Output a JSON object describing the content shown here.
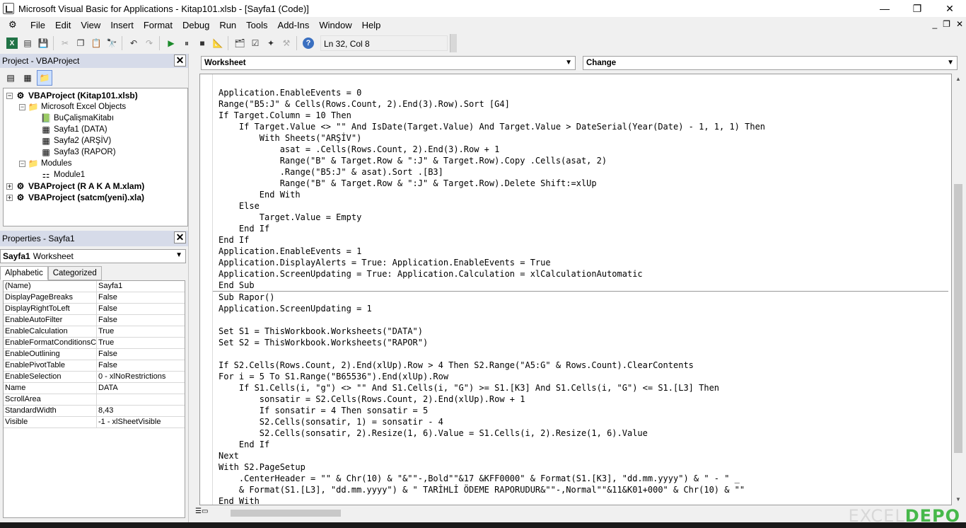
{
  "window": {
    "title": "Microsoft Visual Basic for Applications - Kitap101.xlsb - [Sayfa1 (Code)]",
    "minimize": "—",
    "maximize": "❐",
    "close": "✕"
  },
  "menu": {
    "items": [
      "File",
      "Edit",
      "View",
      "Insert",
      "Format",
      "Debug",
      "Run",
      "Tools",
      "Add-Ins",
      "Window",
      "Help"
    ],
    "mdi_minimize": "_",
    "mdi_restore": "❐",
    "mdi_close": "✕"
  },
  "toolbar": {
    "cursor_position": "Ln 32, Col 8"
  },
  "project": {
    "title": "Project - VBAProject",
    "tree": [
      {
        "label": "VBAProject (Kitap101.xlsb)",
        "level": 0,
        "expander": "−",
        "icon": "vba-project-icon",
        "bold": true
      },
      {
        "label": "Microsoft Excel Objects",
        "level": 1,
        "expander": "−",
        "icon": "folder-icon",
        "bold": false
      },
      {
        "label": "BuÇalişmaKitabı",
        "level": 2,
        "expander": "",
        "icon": "workbook-icon",
        "bold": false
      },
      {
        "label": "Sayfa1 (DATA)",
        "level": 2,
        "expander": "",
        "icon": "sheet-icon",
        "bold": false
      },
      {
        "label": "Sayfa2 (ARŞİV)",
        "level": 2,
        "expander": "",
        "icon": "sheet-icon",
        "bold": false
      },
      {
        "label": "Sayfa3 (RAPOR)",
        "level": 2,
        "expander": "",
        "icon": "sheet-icon",
        "bold": false
      },
      {
        "label": "Modules",
        "level": 1,
        "expander": "−",
        "icon": "folder-icon",
        "bold": false
      },
      {
        "label": "Module1",
        "level": 2,
        "expander": "",
        "icon": "module-icon",
        "bold": false
      },
      {
        "label": "VBAProject (R A K A M.xlam)",
        "level": 0,
        "expander": "+",
        "icon": "vba-project-icon",
        "bold": true
      },
      {
        "label": "VBAProject (satcm(yeni).xla)",
        "level": 0,
        "expander": "+",
        "icon": "vba-project-icon",
        "bold": true
      }
    ]
  },
  "properties": {
    "title": "Properties - Sayfa1",
    "object_name": "Sayfa1",
    "object_type": "Worksheet",
    "tabs": [
      "Alphabetic",
      "Categorized"
    ],
    "rows": [
      {
        "name": "(Name)",
        "value": "Sayfa1"
      },
      {
        "name": "DisplayPageBreaks",
        "value": "False"
      },
      {
        "name": "DisplayRightToLeft",
        "value": "False"
      },
      {
        "name": "EnableAutoFilter",
        "value": "False"
      },
      {
        "name": "EnableCalculation",
        "value": "True"
      },
      {
        "name": "EnableFormatConditionsCa",
        "value": "True"
      },
      {
        "name": "EnableOutlining",
        "value": "False"
      },
      {
        "name": "EnablePivotTable",
        "value": "False"
      },
      {
        "name": "EnableSelection",
        "value": "0 - xlNoRestrictions"
      },
      {
        "name": "Name",
        "value": "DATA"
      },
      {
        "name": "ScrollArea",
        "value": ""
      },
      {
        "name": "StandardWidth",
        "value": "8,43"
      },
      {
        "name": "Visible",
        "value": "-1 - xlSheetVisible"
      }
    ]
  },
  "code": {
    "object_combo": "Worksheet",
    "procedure_combo": "Change",
    "lines_before_separator": [
      "Application.EnableEvents = 0",
      "Range(\"B5:J\" & Cells(Rows.Count, 2).End(3).Row).Sort [G4]",
      "If Target.Column = 10 Then",
      "    If Target.Value <> \"\" And IsDate(Target.Value) And Target.Value > DateSerial(Year(Date) - 1, 1, 1) Then",
      "        With Sheets(\"ARŞİV\")",
      "            asat = .Cells(Rows.Count, 2).End(3).Row + 1",
      "            Range(\"B\" & Target.Row & \":J\" & Target.Row).Copy .Cells(asat, 2)",
      "            .Range(\"B5:J\" & asat).Sort .[B3]",
      "            Range(\"B\" & Target.Row & \":J\" & Target.Row).Delete Shift:=xlUp",
      "        End With",
      "    Else",
      "        Target.Value = Empty",
      "    End If",
      "End If",
      "Application.EnableEvents = 1",
      "Application.DisplayAlerts = True: Application.EnableEvents = True",
      "Application.ScreenUpdating = True: Application.Calculation = xlCalculationAutomatic",
      "End Sub"
    ],
    "lines_after_separator": [
      "Sub Rapor()",
      "Application.ScreenUpdating = 1",
      "",
      "Set S1 = ThisWorkbook.Worksheets(\"DATA\")",
      "Set S2 = ThisWorkbook.Worksheets(\"RAPOR\")",
      "",
      "If S2.Cells(Rows.Count, 2).End(xlUp).Row > 4 Then S2.Range(\"A5:G\" & Rows.Count).ClearContents",
      "For i = 5 To S1.Range(\"B65536\").End(xlUp).Row",
      "    If S1.Cells(i, \"g\") <> \"\" And S1.Cells(i, \"G\") >= S1.[K3] And S1.Cells(i, \"G\") <= S1.[L3] Then",
      "        sonsatir = S2.Cells(Rows.Count, 2).End(xlUp).Row + 1",
      "        If sonsatir = 4 Then sonsatir = 5",
      "        S2.Cells(sonsatir, 1) = sonsatir - 4",
      "        S2.Cells(sonsatir, 2).Resize(1, 6).Value = S1.Cells(i, 2).Resize(1, 6).Value",
      "    End If",
      "Next",
      "With S2.PageSetup",
      "    .CenterHeader = \"\" & Chr(10) & \"&\"\"-,Bold\"\"&17 &KFF0000\" & Format(S1.[K3], \"dd.mm.yyyy\") & \" - \" _",
      "    & Format(S1.[L3], \"dd.mm.yyyy\") & \" TARİHLİ ÖDEME RAPORUDUR&\"\"-,Normal\"\"&11&K01+000\" & Chr(10) & \"\"",
      "End With"
    ]
  },
  "watermark": {
    "main": "EXCEL",
    "accent": "DEPO"
  }
}
